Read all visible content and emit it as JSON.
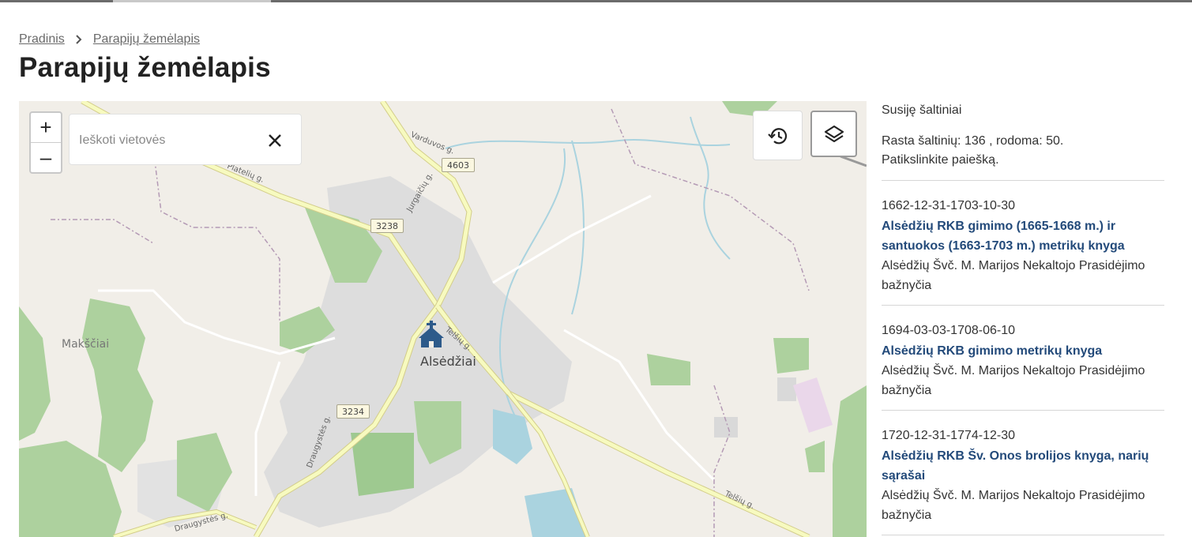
{
  "breadcrumb": {
    "home": "Pradinis",
    "current": "Parapijų žemėlapis"
  },
  "page": {
    "title": "Parapijų žemėlapis"
  },
  "map": {
    "zoom_in": "+",
    "zoom_out": "–",
    "search_placeholder": "Ieškoti vietovės",
    "clear_icon": "close-icon",
    "history_icon": "history-icon",
    "layers_icon": "layers-icon",
    "labels": {
      "town": "Alsėdžiai",
      "village": "Makščiai",
      "streets": [
        "Varduvos g.",
        "Platelių g.",
        "Jurgaičių g.",
        "Telšių g.",
        "Draugystės g.",
        "Telšių g.",
        "Draugystės g."
      ],
      "roads": [
        "4603",
        "3238",
        "3234"
      ]
    },
    "colors": {
      "land": "#f1eee8",
      "forest": "#add19e",
      "urban": "#dddddd",
      "water": "#aad3df",
      "road": "#f7fabf"
    }
  },
  "sidebar": {
    "title": "Susiję šaltiniai",
    "found_line1": "Rasta šaltinių: 136 , rodoma: 50.",
    "found_line2": "Patikslinkite paiešką.",
    "items": [
      {
        "date": "1662-12-31-1703-10-30",
        "title": "Alsėdžių RKB gimimo (1665-1668 m.) ir santuokos (1663-1703 m.) metrikų knyga",
        "church": "Alsėdžių Švč. M. Marijos Nekaltojo Prasidėjimo bažnyčia"
      },
      {
        "date": "1694-03-03-1708-06-10",
        "title": "Alsėdžių RKB gimimo metrikų knyga",
        "church": "Alsėdžių Švč. M. Marijos Nekaltojo Prasidėjimo bažnyčia"
      },
      {
        "date": "1720-12-31-1774-12-30",
        "title": "Alsėdžių RKB Šv. Onos brolijos knyga, narių sąrašai",
        "church": "Alsėdžių Švč. M. Marijos Nekaltojo Prasidėjimo bažnyčia"
      }
    ]
  }
}
